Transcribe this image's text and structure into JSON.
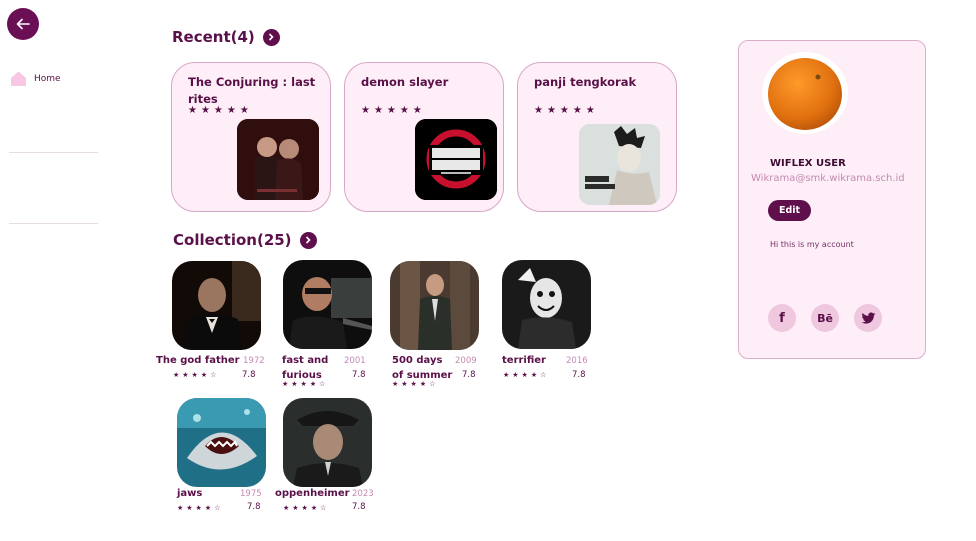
{
  "sidebar": {
    "back_icon": "arrow-left-icon",
    "home_icon": "home-icon",
    "home_label": "Home"
  },
  "recent": {
    "heading": "Recent(4)",
    "cards": [
      {
        "title": "The Conjuring : last rites",
        "stars": "★★★★★",
        "image": "the-conjuring-poster"
      },
      {
        "title": "demon slayer",
        "stars": "★★★★★",
        "image": "demon-slayer-logo"
      },
      {
        "title": "panji tengkorak",
        "stars": "★★★★★",
        "image": "panji-tengkorak-poster"
      }
    ]
  },
  "collection": {
    "heading": "Collection(25)",
    "items": [
      {
        "title": "The god father",
        "year": "1972",
        "stars": "★★★★☆",
        "rating": "7.8"
      },
      {
        "title": "fast and furious",
        "year": "2001",
        "stars": "★★★★☆",
        "rating": "7.8"
      },
      {
        "title": "500 days of summer",
        "year": "2009",
        "stars": "★★★★☆",
        "rating": "7.8"
      },
      {
        "title": "terrifier",
        "year": "2016",
        "stars": "★★★★☆",
        "rating": "7.8"
      },
      {
        "title": "jaws",
        "year": "1975",
        "stars": "★★★★☆",
        "rating": "7.8"
      },
      {
        "title": "oppenheimer",
        "year": "2023",
        "stars": "★★★★☆",
        "rating": "7.8"
      }
    ]
  },
  "profile": {
    "username": "WIFLEX USER",
    "email": "Wikrama@smk.wikrama.sch.id",
    "edit_label": "Edit",
    "bio": "Hi this is my account",
    "socials": [
      {
        "icon": "facebook-icon",
        "glyph": "f"
      },
      {
        "icon": "behance-icon",
        "glyph": "Bē"
      },
      {
        "icon": "twitter-icon",
        "glyph": ""
      }
    ]
  },
  "colors": {
    "accent": "#5e0f4c",
    "card_bg": "#fdeef8",
    "card_border": "#d9a6c8",
    "muted": "#c48ab2"
  }
}
